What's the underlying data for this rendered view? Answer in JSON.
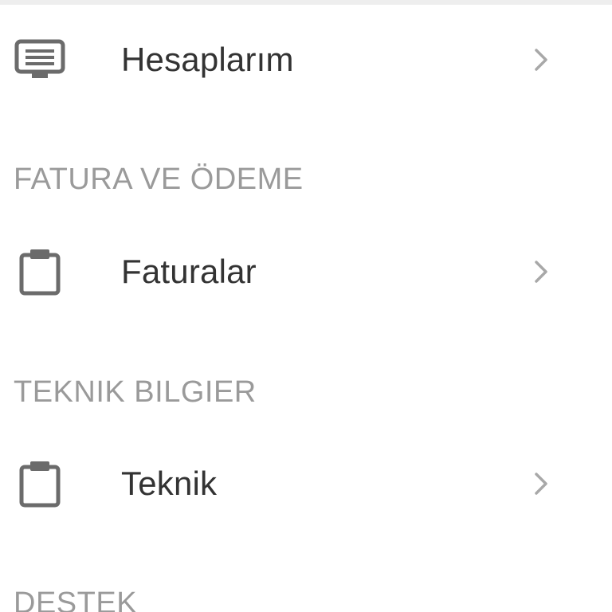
{
  "menu": {
    "accounts": {
      "label": "Hesaplarım",
      "icon": "monitor-list-icon"
    },
    "invoices": {
      "label": "Faturalar",
      "icon": "clipboard-icon"
    },
    "technical": {
      "label": "Teknik",
      "icon": "clipboard-icon"
    }
  },
  "sections": {
    "billing": "FATURA VE ÖDEME",
    "technical_info": "TEKNIK BILGIER",
    "support": "DESTEK"
  },
  "icons": {
    "chevron": "chevron-right-icon"
  },
  "colors": {
    "label_text": "#333333",
    "section_text": "#9a9a9a",
    "icon": "#6b6b6b",
    "chevron": "#a8a8a8"
  }
}
